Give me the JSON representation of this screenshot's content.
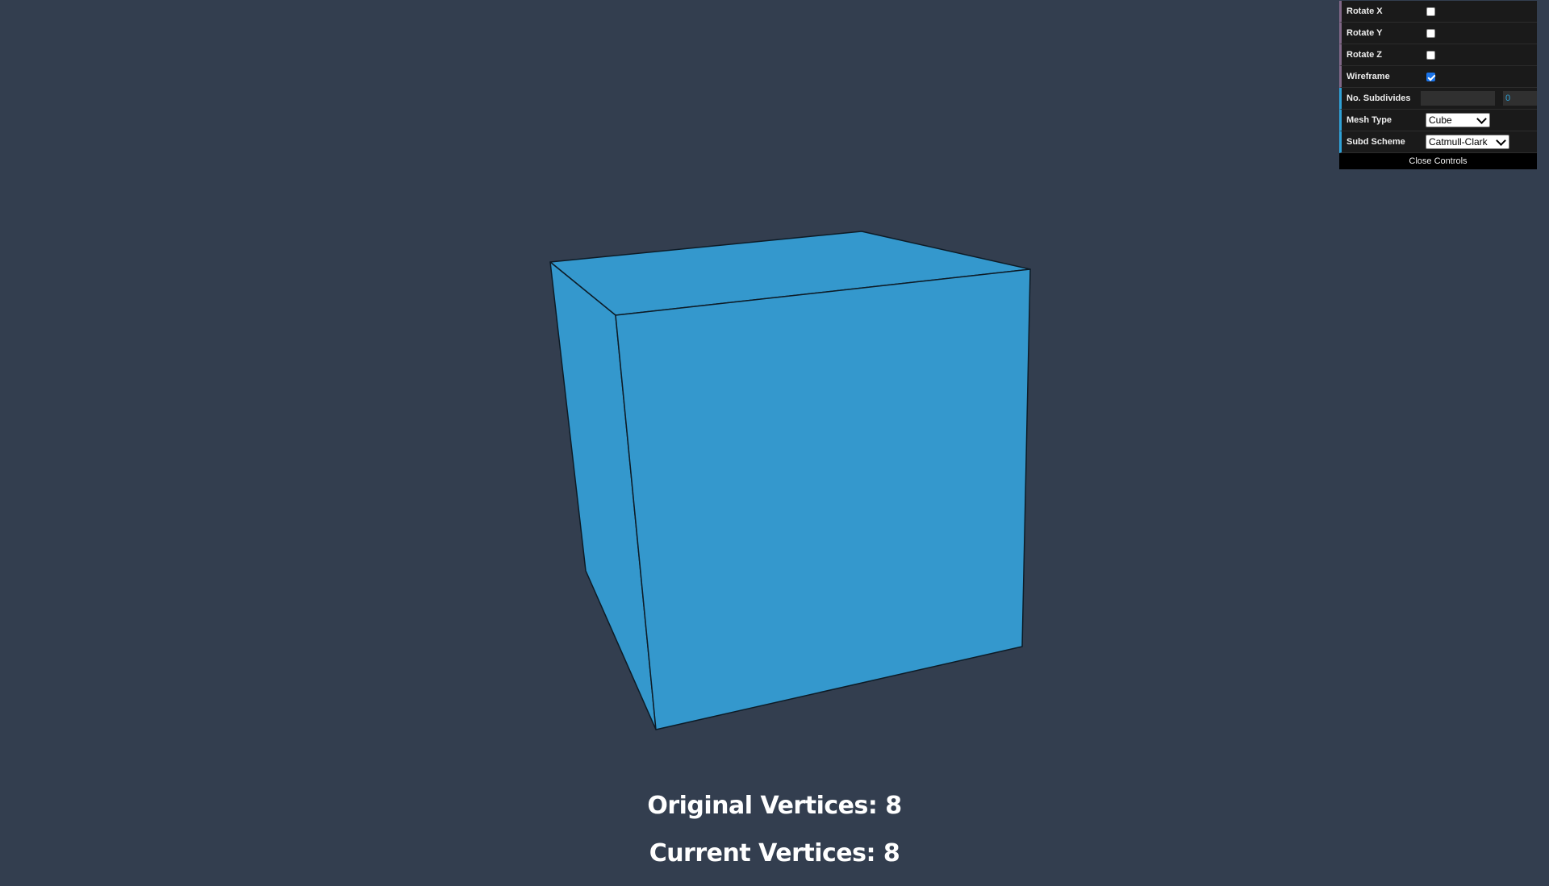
{
  "colors": {
    "background": "#333e4f",
    "mesh_fill": "#3498cd",
    "mesh_edge": "#0d1b26",
    "panel_bg": "#1a1a1a",
    "accent": "#2fa1d6"
  },
  "controls": {
    "rotate_x": {
      "label": "Rotate X",
      "checked": false
    },
    "rotate_y": {
      "label": "Rotate Y",
      "checked": false
    },
    "rotate_z": {
      "label": "Rotate Z",
      "checked": false
    },
    "wireframe": {
      "label": "Wireframe",
      "checked": true
    },
    "subdivides": {
      "label": "No. Subdivides",
      "value": "0"
    },
    "mesh_type": {
      "label": "Mesh Type",
      "value": "Cube"
    },
    "subd_scheme": {
      "label": "Subd Scheme",
      "value": "Catmull-Clark"
    },
    "close_label": "Close Controls"
  },
  "stats": {
    "original": "Original Vertices: 8",
    "current": "Current Vertices: 8"
  },
  "mesh": {
    "type": "Cube",
    "vertices": 8
  }
}
